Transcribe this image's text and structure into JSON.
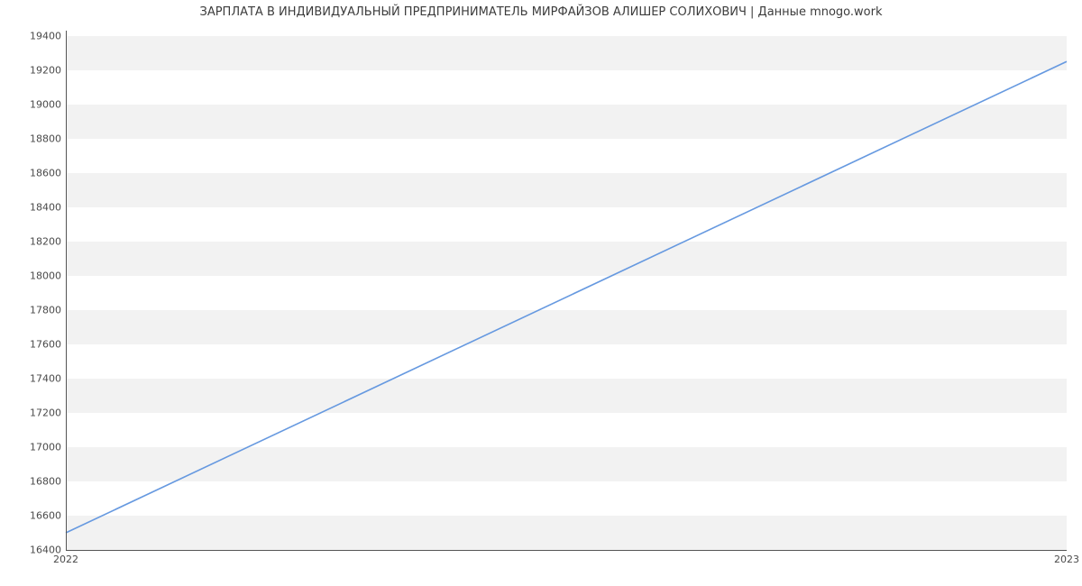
{
  "chart_data": {
    "type": "line",
    "title": "ЗАРПЛАТА В ИНДИВИДУАЛЬНЫЙ ПРЕДПРИНИМАТЕЛЬ МИРФАЙЗОВ АЛИШЕР СОЛИХОВИЧ | Данные mnogo.work",
    "xlabel": "",
    "ylabel": "",
    "x": [
      2022,
      2023
    ],
    "values": [
      16500,
      19250
    ],
    "x_ticks": [
      2022,
      2023
    ],
    "y_ticks": [
      16400,
      16600,
      16800,
      17000,
      17200,
      17400,
      17600,
      17800,
      18000,
      18200,
      18400,
      18600,
      18800,
      19000,
      19200,
      19400
    ],
    "ylim": [
      16400,
      19430
    ],
    "xlim": [
      2022,
      2023
    ],
    "line_color": "#6699e0"
  }
}
